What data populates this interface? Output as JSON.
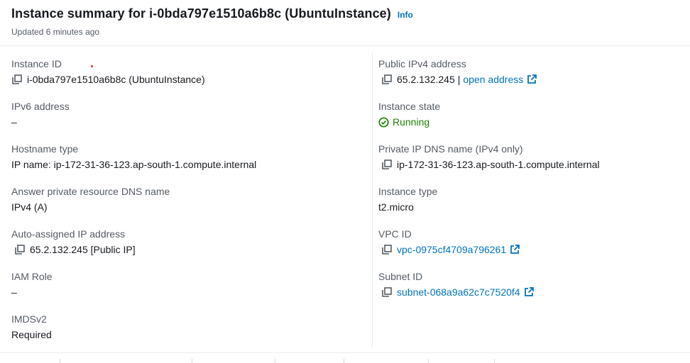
{
  "header": {
    "title": "Instance summary for i-0bda797e1510a6b8c (UbuntuInstance)",
    "info_label": "Info",
    "updated": "Updated 6 minutes ago"
  },
  "left": {
    "instance_id": {
      "label": "Instance ID",
      "value": "i-0bda797e1510a6b8c (UbuntuInstance)"
    },
    "ipv6": {
      "label": "IPv6 address",
      "value": "–"
    },
    "hostname_type": {
      "label": "Hostname type",
      "value": "IP name: ip-172-31-36-123.ap-south-1.compute.internal"
    },
    "answer_dns": {
      "label": "Answer private resource DNS name",
      "value": "IPv4 (A)"
    },
    "auto_ip": {
      "label": "Auto-assigned IP address",
      "value": "65.2.132.245 [Public IP]"
    },
    "iam_role": {
      "label": "IAM Role",
      "value": "–"
    },
    "imdsv2": {
      "label": "IMDSv2",
      "value": "Required"
    }
  },
  "right": {
    "public_ipv4": {
      "label": "Public IPv4 address",
      "value": "65.2.132.245",
      "sep": "|",
      "link": "open address"
    },
    "instance_state": {
      "label": "Instance state",
      "value": "Running"
    },
    "private_dns": {
      "label": "Private IP DNS name (IPv4 only)",
      "value": "ip-172-31-36-123.ap-south-1.compute.internal"
    },
    "instance_type": {
      "label": "Instance type",
      "value": "t2.micro"
    },
    "vpc_id": {
      "label": "VPC ID",
      "value": "vpc-0975cf4709a796261"
    },
    "subnet_id": {
      "label": "Subnet ID",
      "value": "subnet-068a9a62c7c7520f4"
    }
  },
  "colors": {
    "link": "#0073bb",
    "success": "#1d8102",
    "label": "#545b64",
    "text": "#16191f",
    "border": "#eaeded"
  },
  "icons": [
    "copy-icon",
    "external-link-icon",
    "status-check-icon"
  ]
}
